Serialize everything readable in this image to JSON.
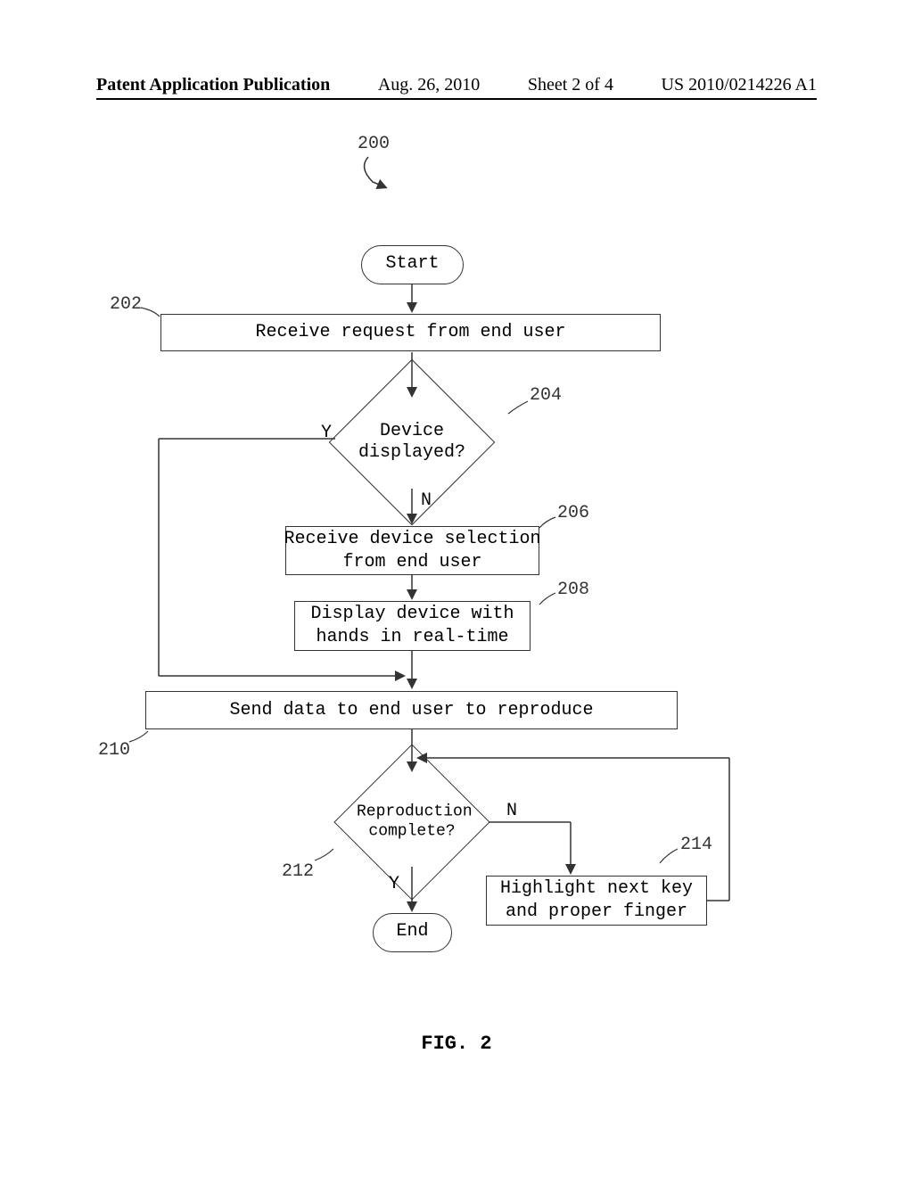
{
  "header": {
    "pub_type": "Patent Application Publication",
    "date": "Aug. 26, 2010",
    "sheet": "Sheet 2 of 4",
    "pub_number": "US 2010/0214226 A1"
  },
  "refs": {
    "r200": "200",
    "r202": "202",
    "r204": "204",
    "r206": "206",
    "r208": "208",
    "r210": "210",
    "r212": "212",
    "r214": "214"
  },
  "nodes": {
    "start": "Start",
    "n202": "Receive request from end user",
    "n204": "Device\ndisplayed?",
    "n206": "Receive device selection\nfrom end user",
    "n208": "Display device with\nhands in real-time",
    "n210": "Send data to end user to reproduce",
    "n212": "Reproduction\ncomplete?",
    "n214": "Highlight next key\nand proper finger",
    "end": "End"
  },
  "edge_labels": {
    "y1": "Y",
    "n1": "N",
    "y2": "Y",
    "n2": "N"
  },
  "figure_label": "FIG. 2"
}
